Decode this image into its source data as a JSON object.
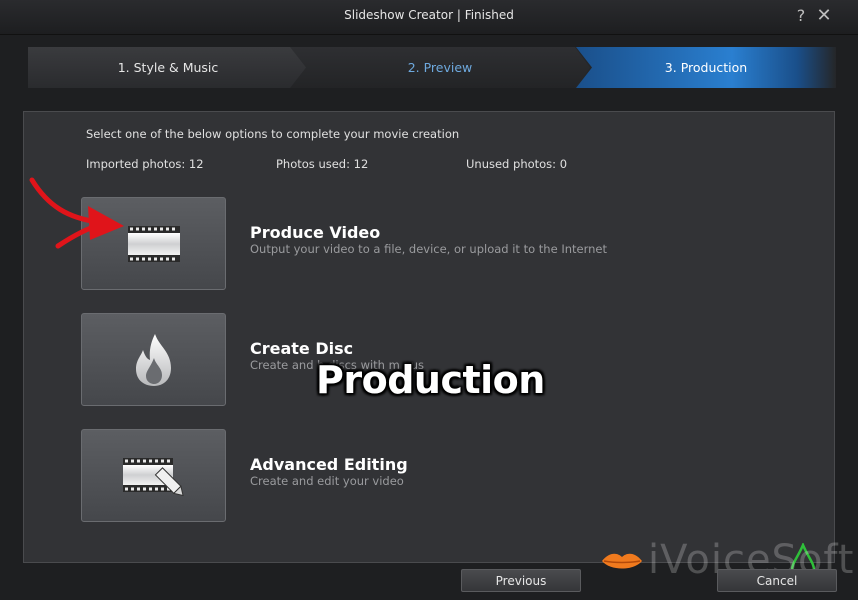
{
  "window": {
    "title": "Slideshow Creator | Finished",
    "help_label": "?",
    "close_label": "✕"
  },
  "steps": [
    {
      "label": "1. Style & Music",
      "state": "done"
    },
    {
      "label": "2. Preview",
      "state": "link"
    },
    {
      "label": "3. Production",
      "state": "active"
    }
  ],
  "main": {
    "instruction": "Select one of the below options to complete your movie creation",
    "stats": {
      "imported": "Imported photos: 12",
      "used": "Photos used: 12",
      "unused": "Unused photos: 0"
    },
    "options": [
      {
        "title": "Produce Video",
        "description": "Output your video to a file, device, or upload it to the Internet",
        "icon": "film-strip-icon"
      },
      {
        "title": "Create Disc",
        "description": "Create and b      discs with m    nus",
        "icon": "flame-icon"
      },
      {
        "title": "Advanced Editing",
        "description": "Create and edit your video",
        "icon": "film-edit-icon"
      }
    ]
  },
  "overlay_caption": "Production",
  "footer": {
    "previous_label": "Previous",
    "cancel_label": "Cancel"
  },
  "watermark": {
    "text": "iVoiceSoft"
  },
  "colors": {
    "accent_blue": "#2a7fd0",
    "preview_link": "#6ea9de",
    "arrow_red": "#e0141a"
  }
}
